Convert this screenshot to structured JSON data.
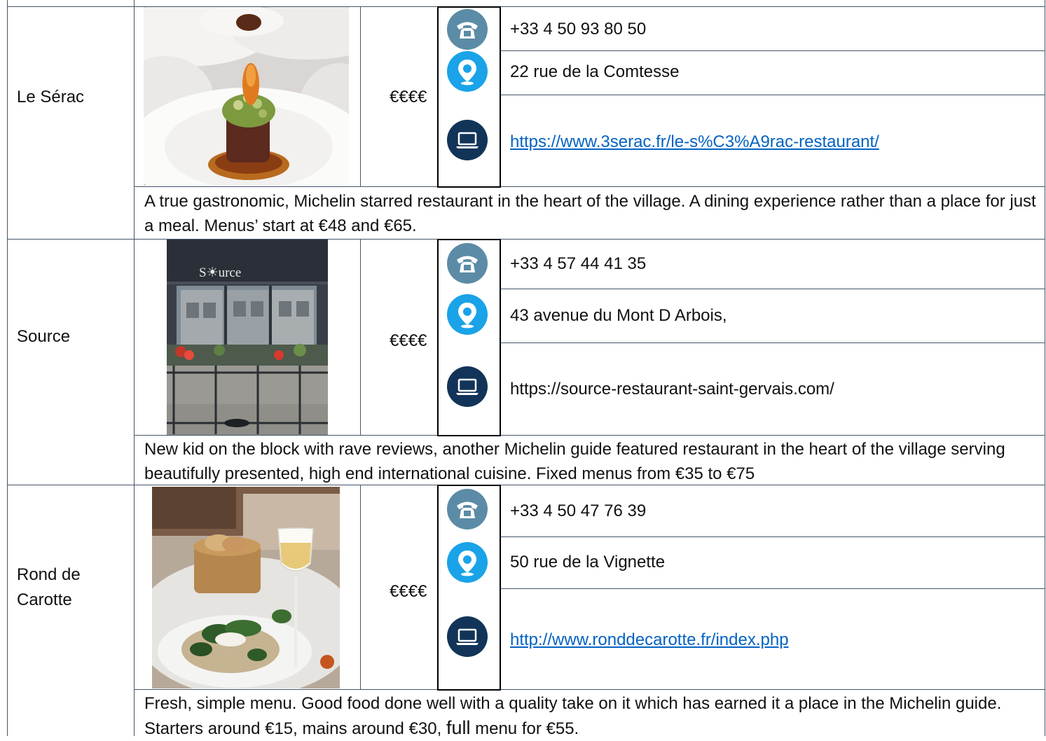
{
  "restaurants": [
    {
      "name": "Le Sérac",
      "price": "€€€€",
      "phone": "+33 4 50 93 80 50",
      "address": "22 rue de la Comtesse",
      "website": "https://www.3serac.fr/le-s%C3%A9rac-restaurant/",
      "website_is_link": true,
      "description": "A true gastronomic, Michelin starred restaurant in the heart of the village. A dining experience rather than a place for just a meal. Menus’ start at €48 and €65."
    },
    {
      "name": "Source",
      "price": "€€€€",
      "phone": "+33 4 57 44 41 35",
      "address": "43 avenue du Mont D Arbois,",
      "website": "https://source-restaurant-saint-gervais.com/",
      "website_is_link": false,
      "photo_sign": "S☀urce",
      "description": "New kid on the block with rave reviews, another Michelin guide featured restaurant in the heart of the village serving beautifully presented, high end international cuisine. Fixed menus from €35 to €75"
    },
    {
      "name": "Rond de Carotte",
      "price": "€€€€",
      "phone": "+33 4 50 47 76 39",
      "address": "50 rue de la Vignette",
      "website": "http://www.ronddecarotte.fr/index.php",
      "website_is_link": true,
      "description_parts": [
        "Fresh, simple menu. Good food done well with a quality take on it which has earned it a place in the Michelin guide. Starters around €15, mains around €30, ",
        "full",
        " menu for €55."
      ]
    }
  ],
  "icons": {
    "phone": "phone-icon",
    "address": "location-pin-icon",
    "website": "laptop-icon"
  },
  "colors": {
    "border": "#44546a",
    "link": "#0563c1",
    "phone_icon": "#5b8ba6",
    "pin_icon": "#1aa3e8",
    "laptop_icon": "#123458"
  }
}
